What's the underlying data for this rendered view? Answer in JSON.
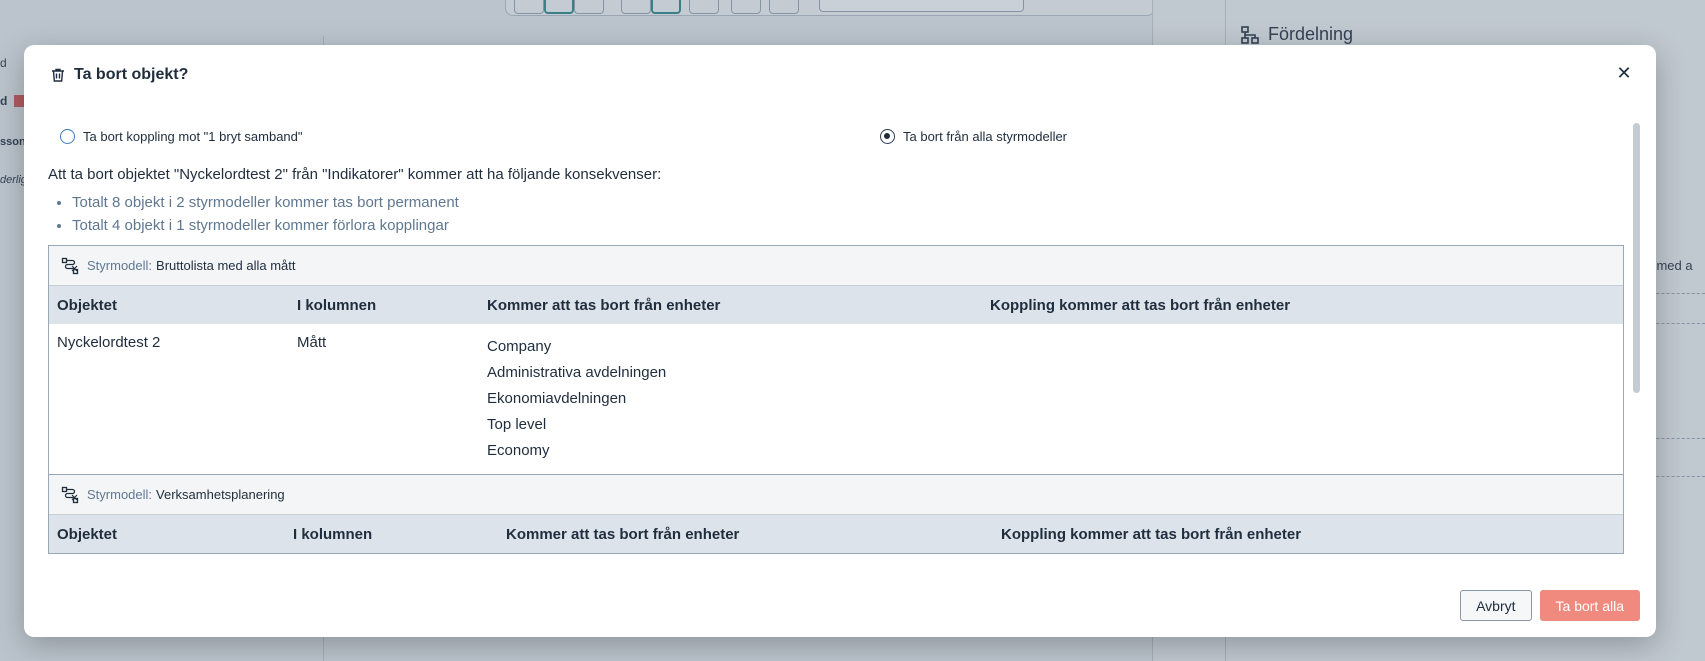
{
  "background": {
    "right_panel_title": "Fördelning",
    "left_fragments": [
      "d",
      "sson",
      "derlig"
    ],
    "right_fragment": "ta med a"
  },
  "modal": {
    "title": "Ta bort objekt?",
    "close_icon": "close-icon",
    "options": [
      {
        "label": "Ta bort koppling mot \"1 bryt samband\"",
        "checked": false
      },
      {
        "label": "Ta bort från alla styrmodeller",
        "checked": true
      }
    ],
    "consequence_text": "Att ta bort objektet \"Nyckelordtest 2\" från \"Indikatorer\" kommer att ha följande konsekvenser:",
    "bullets": [
      "Totalt 8 objekt i 2 styrmodeller kommer tas bort permanent",
      "Totalt 4 objekt i 1 styrmodeller kommer förlora kopplingar"
    ],
    "models": [
      {
        "key": "Styrmodell:",
        "name": "Bruttolista med alla mått",
        "columns": [
          "Objektet",
          "I kolumnen",
          "Kommer att tas bort från enheter",
          "Koppling kommer att tas bort från enheter"
        ],
        "rows": [
          {
            "object": "Nyckelordtest 2",
            "column": "Mått",
            "units": [
              "Company",
              "Administrativa avdelningen",
              "Ekonomiavdelningen",
              "Top level",
              "Economy"
            ],
            "link_units": []
          }
        ]
      },
      {
        "key": "Styrmodell:",
        "name": "Verksamhetsplanering",
        "columns": [
          "Objektet",
          "I kolumnen",
          "Kommer att tas bort från enheter",
          "Koppling kommer att tas bort från enheter"
        ],
        "rows": []
      }
    ],
    "buttons": {
      "cancel": "Avbryt",
      "delete": "Ta bort alla"
    },
    "colors": {
      "delete_button": "#f08a7e",
      "muted_text": "#5f7891",
      "table_header": "#dde3ea"
    }
  }
}
